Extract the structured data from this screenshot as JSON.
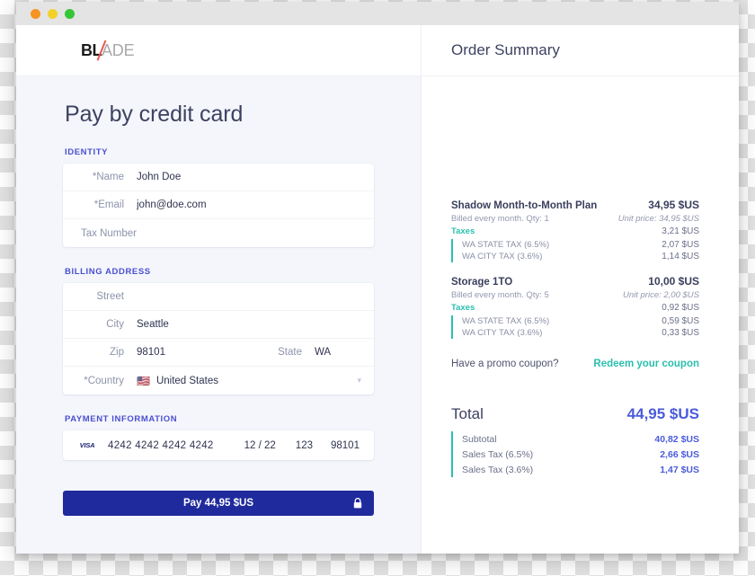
{
  "window": {
    "traffic_lights": [
      "close",
      "minimize",
      "maximize"
    ]
  },
  "brand": {
    "logo_part1": "BL",
    "logo_part2": "ADE"
  },
  "checkout": {
    "title": "Pay by credit card",
    "sections": {
      "identity": {
        "label": "IDENTITY",
        "rows": [
          {
            "label": "*Name",
            "value": "John Doe"
          },
          {
            "label": "*Email",
            "value": "john@doe.com"
          },
          {
            "label": "Tax Number",
            "value": ""
          }
        ]
      },
      "billing": {
        "label": "BILLING ADDRESS",
        "rows": [
          {
            "label": "Street",
            "value": ""
          },
          {
            "label": "City",
            "value": "Seattle"
          }
        ],
        "zip_label": "Zip",
        "zip_value": "98101",
        "state_label": "State",
        "state_value": "WA",
        "country_label": "*Country",
        "country_flag": "🇺🇸",
        "country_value": "United States",
        "country_chevron": "▾"
      },
      "payment": {
        "label": "PAYMENT INFORMATION",
        "brand_icon": "VISA",
        "card_number": "4242 4242 4242 4242",
        "expiry": "12 / 22",
        "cvc": "123",
        "zip": "98101"
      }
    },
    "pay_button": {
      "label": "Pay 44,95 $US",
      "lock_icon": "lock-icon"
    }
  },
  "order_summary": {
    "title": "Order Summary",
    "items": [
      {
        "name": "Shadow Month-to-Month Plan",
        "price": "34,95 $US",
        "billing_note": "Billed every month. Qty: 1",
        "unit_price": "Unit price: 34,95 $US",
        "taxes_label": "Taxes",
        "taxes_total": "3,21 $US",
        "taxes": [
          {
            "name": "WA STATE TAX (6.5%)",
            "value": "2,07 $US"
          },
          {
            "name": "WA CITY TAX (3.6%)",
            "value": "1,14 $US"
          }
        ]
      },
      {
        "name": "Storage 1TO",
        "price": "10,00 $US",
        "billing_note": "Billed every month. Qty: 5",
        "unit_price": "Unit price: 2,00 $US",
        "taxes_label": "Taxes",
        "taxes_total": "0,92 $US",
        "taxes": [
          {
            "name": "WA STATE TAX (6.5%)",
            "value": "0,59 $US"
          },
          {
            "name": "WA CITY TAX (3.6%)",
            "value": "0,33 $US"
          }
        ]
      }
    ],
    "promo": {
      "question": "Have a promo coupon?",
      "link": "Redeem your coupon"
    },
    "total": {
      "label": "Total",
      "value": "44,95 $US",
      "rows": [
        {
          "name": "Subtotal",
          "value": "40,82 $US"
        },
        {
          "name": "Sales Tax (6.5%)",
          "value": "2,66 $US"
        },
        {
          "name": "Sales Tax (3.6%)",
          "value": "1,47 $US"
        }
      ]
    }
  },
  "colors": {
    "accent_blue": "#4a5bdc",
    "accent_teal": "#2bbfae",
    "section_label": "#4b4fd0",
    "pay_button": "#1f2a9c",
    "text_dark": "#3a3f5c",
    "text_muted": "#9398ae"
  }
}
